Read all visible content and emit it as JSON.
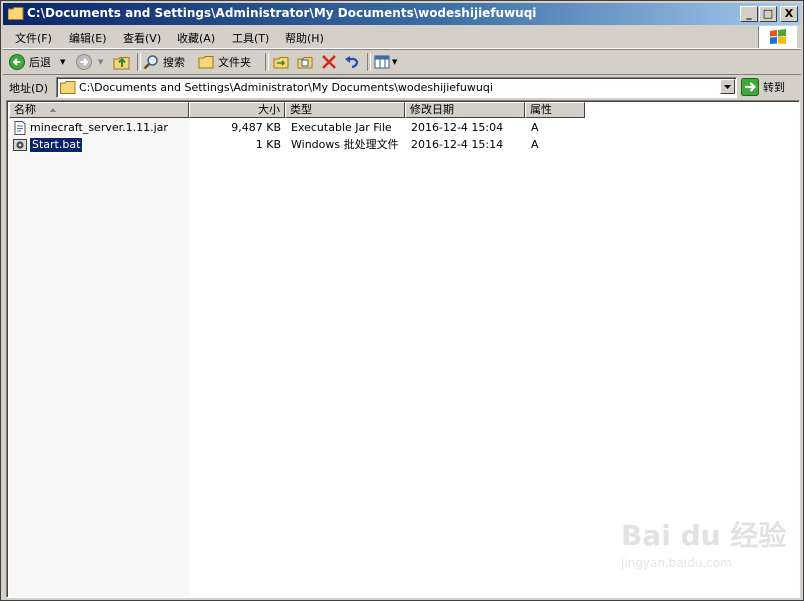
{
  "window": {
    "title": "C:\\Documents and Settings\\Administrator\\My Documents\\wodeshijiefuwuqi",
    "min": "_",
    "max": "□",
    "close": "X"
  },
  "menu": [
    "文件(F)",
    "编辑(E)",
    "查看(V)",
    "收藏(A)",
    "工具(T)",
    "帮助(H)"
  ],
  "toolbar": {
    "back": "后退",
    "search": "搜索",
    "folders": "文件夹"
  },
  "address": {
    "label": "地址(D)",
    "value": "C:\\Documents and Settings\\Administrator\\My Documents\\wodeshijiefuwuqi",
    "go": "转到"
  },
  "list": {
    "columns": [
      "名称",
      "大小",
      "类型",
      "修改日期",
      "属性"
    ],
    "rows": [
      {
        "name": "minecraft_server.1.11.jar",
        "size": "9,487 KB",
        "type": "Executable Jar File",
        "modified": "2016-12-4 15:04",
        "attr": "A",
        "selected": false
      },
      {
        "name": "Start.bat",
        "size": "1 KB",
        "type": "Windows 批处理文件",
        "modified": "2016-12-4 15:14",
        "attr": "A",
        "selected": true
      }
    ]
  },
  "watermark": {
    "main": "Bai du 经验",
    "sub": "jingyan.baidu.com"
  },
  "colors": {
    "title_start": "#0a246a",
    "title_end": "#a6caf0",
    "selection": "#0a246a",
    "face": "#d4d0c8"
  }
}
